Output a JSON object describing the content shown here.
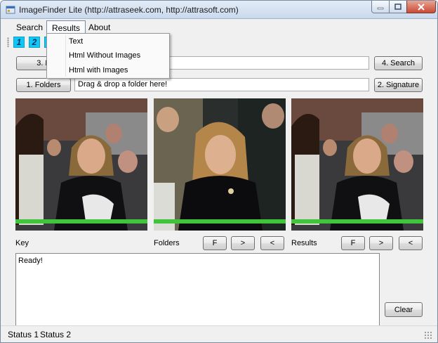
{
  "window": {
    "title": "ImageFinder Lite (http://attraseek.com, http://attrasoft.com)",
    "app_icon": "app-window-icon",
    "controls": {
      "minimize_icon": "minimize-icon",
      "maximize_icon": "maximize-icon",
      "close_icon": "close-icon"
    }
  },
  "menubar": {
    "items": [
      {
        "label": "Search"
      },
      {
        "label": "Results"
      },
      {
        "label": "About"
      }
    ]
  },
  "results_menu": {
    "items": [
      {
        "label": "Text"
      },
      {
        "label": "Html Without Images"
      },
      {
        "label": "Html with Images"
      }
    ]
  },
  "toolbar": {
    "buttons": [
      {
        "label": "1"
      },
      {
        "label": "2"
      },
      {
        "label": "3"
      }
    ]
  },
  "key_row": {
    "button_label": "3. K",
    "input_value": "",
    "search_button": "4. Search"
  },
  "folder_row": {
    "button_label": "1. Folders",
    "input_value": "Drag & drop a folder here!",
    "signature_button": "2. Signature"
  },
  "panels": {
    "key_label": "Key",
    "folders_label": "Folders",
    "results_label": "Results",
    "folders_nav": {
      "first": "F",
      "next": ">",
      "prev": "<"
    },
    "results_nav": {
      "first": "F",
      "next": ">",
      "prev": "<"
    }
  },
  "output": {
    "text": "Ready!",
    "clear_button": "Clear"
  },
  "statusbar": {
    "status1": "Status 1",
    "status2": "Status 2"
  },
  "colors": {
    "accent_toolbar": "#10c8f4",
    "green_strip": "#3fc43b"
  }
}
